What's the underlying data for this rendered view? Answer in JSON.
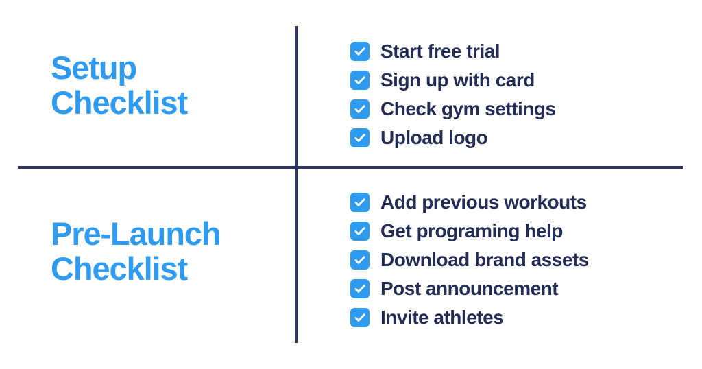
{
  "colors": {
    "accent_blue": "#2e9bf0",
    "text_navy": "#222c54",
    "divider_navy": "#2a3560",
    "background": "#ffffff",
    "check_mark": "#ffffff"
  },
  "quadrants": {
    "top_left": {
      "heading_line_1": "Setup",
      "heading_line_2": "Checklist"
    },
    "bottom_left": {
      "heading_line_1": "Pre-Launch",
      "heading_line_2": "Checklist"
    },
    "top_right": {
      "items": [
        {
          "label": "Start free trial",
          "checked": true
        },
        {
          "label": "Sign up with card",
          "checked": true
        },
        {
          "label": "Check gym settings",
          "checked": true
        },
        {
          "label": "Upload logo",
          "checked": true
        }
      ]
    },
    "bottom_right": {
      "items": [
        {
          "label": "Add previous workouts",
          "checked": true
        },
        {
          "label": "Get programing help",
          "checked": true
        },
        {
          "label": "Download brand assets",
          "checked": true
        },
        {
          "label": "Post announcement",
          "checked": true
        },
        {
          "label": "Invite athletes",
          "checked": true
        }
      ]
    }
  },
  "icons": {
    "checkbox_checked": "checkbox-checked-icon"
  }
}
